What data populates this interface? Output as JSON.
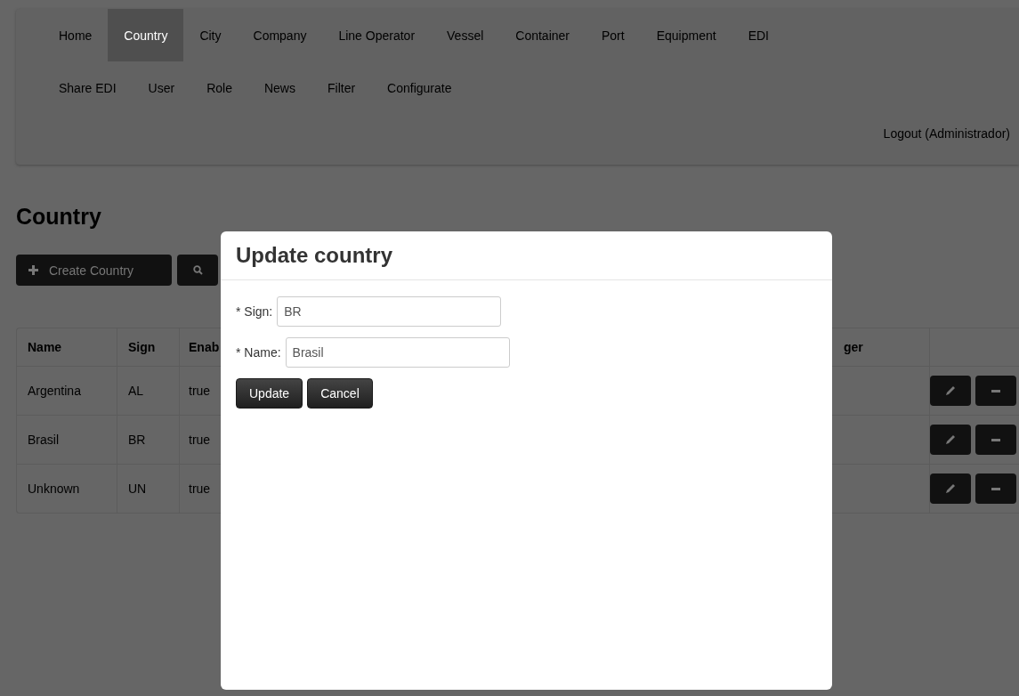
{
  "nav": {
    "rows": [
      [
        {
          "label": "Home",
          "selected": false
        },
        {
          "label": "Country",
          "selected": true
        },
        {
          "label": "City",
          "selected": false
        },
        {
          "label": "Company",
          "selected": false
        },
        {
          "label": "Line Operator",
          "selected": false
        },
        {
          "label": "Vessel",
          "selected": false
        },
        {
          "label": "Container",
          "selected": false
        },
        {
          "label": "Port",
          "selected": false
        },
        {
          "label": "Equipment",
          "selected": false
        },
        {
          "label": "EDI",
          "selected": false
        }
      ],
      [
        {
          "label": "Share EDI",
          "selected": false
        },
        {
          "label": "User",
          "selected": false
        },
        {
          "label": "Role",
          "selected": false
        },
        {
          "label": "News",
          "selected": false
        },
        {
          "label": "Filter",
          "selected": false
        },
        {
          "label": "Configurate",
          "selected": false
        }
      ]
    ],
    "logout": "Logout (Administrador)"
  },
  "page": {
    "title": "Country",
    "create_button": "Create Country"
  },
  "table": {
    "columns": [
      "Name",
      "Sign",
      "Enab",
      "ger"
    ],
    "rows": [
      {
        "cells": [
          "Argentina",
          "AL",
          "true"
        ]
      },
      {
        "cells": [
          "Brasil",
          "BR",
          "true"
        ]
      },
      {
        "cells": [
          "Unknown",
          "UN",
          "true"
        ]
      }
    ]
  },
  "modal": {
    "title": "Update country",
    "fields": [
      {
        "label": "* Sign:",
        "value": "BR"
      },
      {
        "label": "* Name:",
        "value": "Brasil"
      }
    ],
    "buttons": [
      "Update",
      "Cancel"
    ]
  }
}
